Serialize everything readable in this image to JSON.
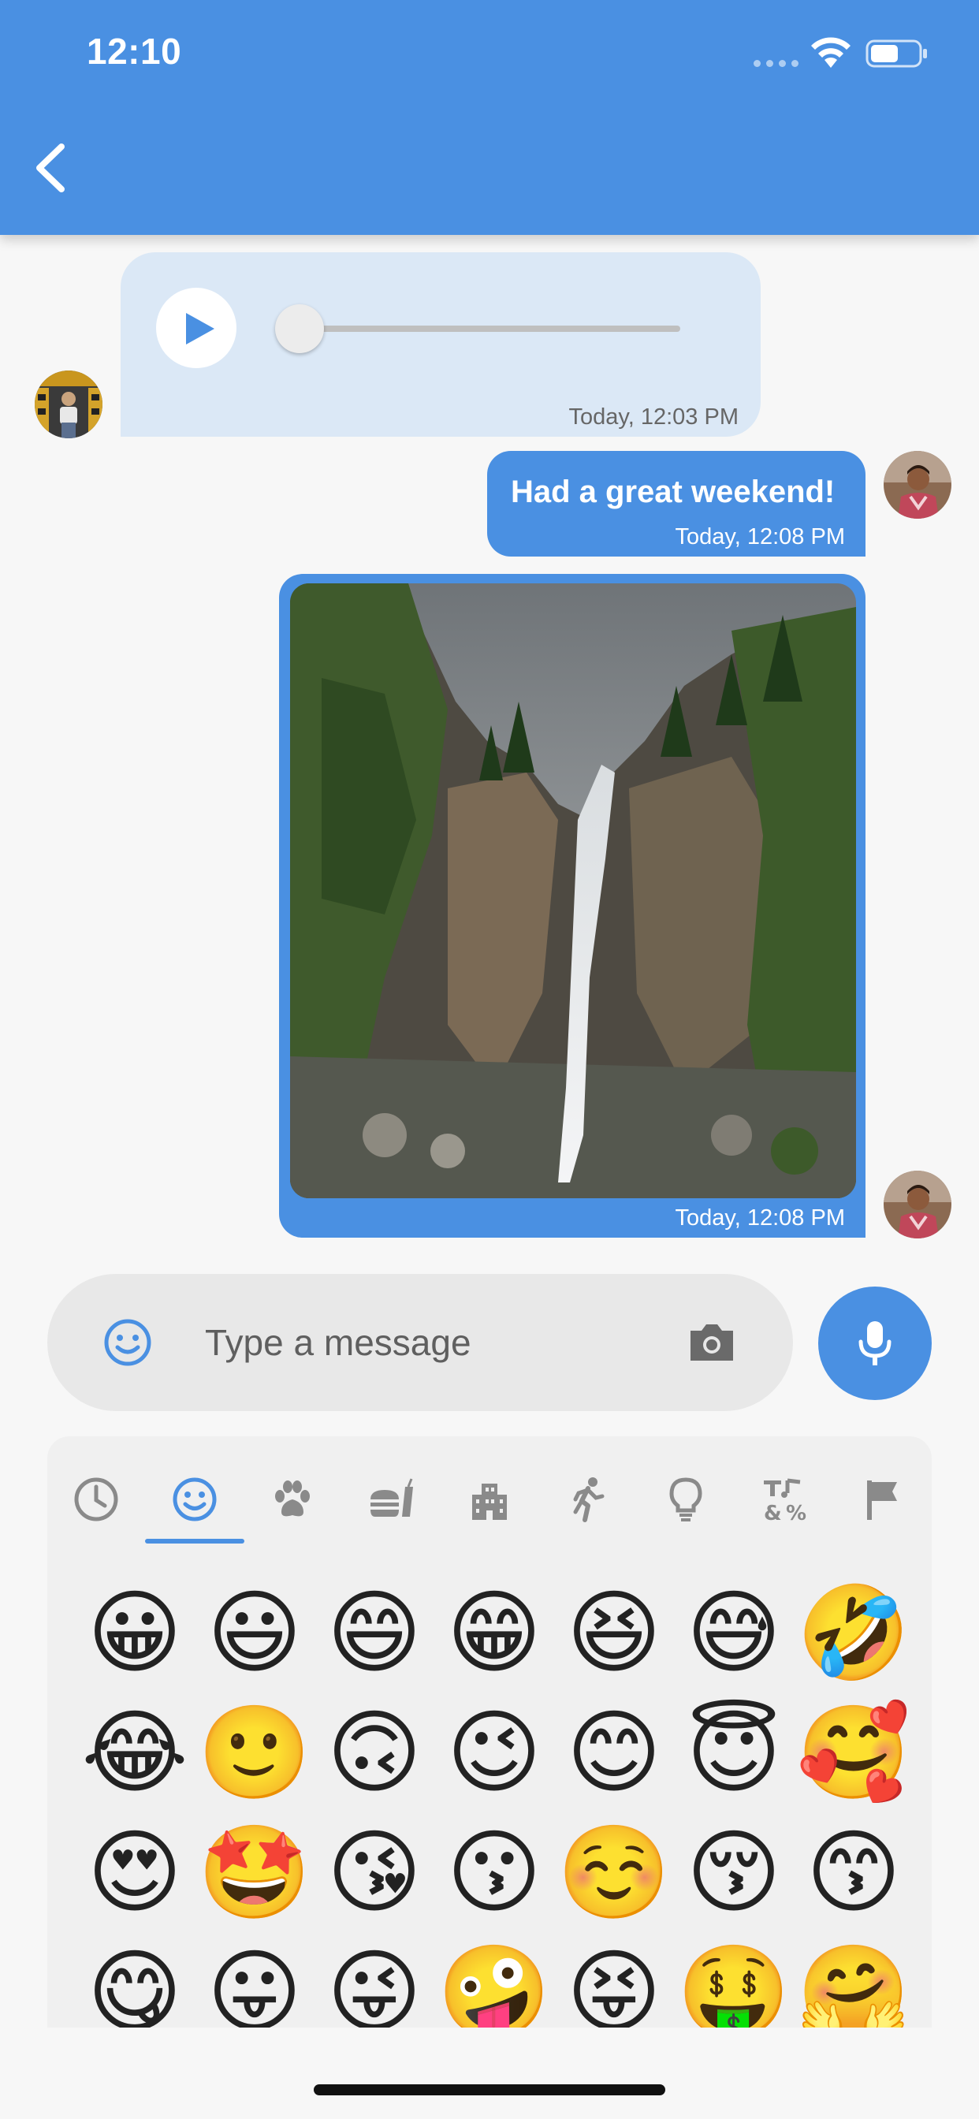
{
  "status_bar": {
    "time": "12:10"
  },
  "header": {
    "back_icon": "chevron-left-icon",
    "color": "#4a90e2"
  },
  "messages": [
    {
      "type": "audio",
      "side": "incoming",
      "time": "Today, 12:03 PM",
      "progress": 0
    },
    {
      "type": "text",
      "side": "outgoing",
      "text": "Had a great weekend!",
      "time": "Today, 12:08 PM"
    },
    {
      "type": "image",
      "side": "outgoing",
      "time": "Today, 12:08 PM"
    }
  ],
  "input": {
    "placeholder": "Type a message",
    "value": ""
  },
  "emoji_picker": {
    "categories": [
      "recent",
      "smileys",
      "animals",
      "food",
      "travel",
      "activities",
      "objects",
      "symbols",
      "flags"
    ],
    "selected_category": "smileys",
    "emojis": [
      [
        "😀",
        "😃",
        "😄",
        "😁",
        "😆",
        "😅",
        "🤣"
      ],
      [
        "😂",
        "🙂",
        "🙃",
        "😉",
        "😊",
        "😇",
        "🥰"
      ],
      [
        "😍",
        "🤩",
        "😘",
        "😗",
        "☺️",
        "😚",
        "😙"
      ],
      [
        "😋",
        "😛",
        "😜",
        "🤪",
        "😝",
        "🤑",
        "🤗"
      ]
    ]
  },
  "colors": {
    "accent": "#4a90e2",
    "incoming_bubble": "#dbe8f6",
    "input_bg": "#e8e8e8"
  }
}
